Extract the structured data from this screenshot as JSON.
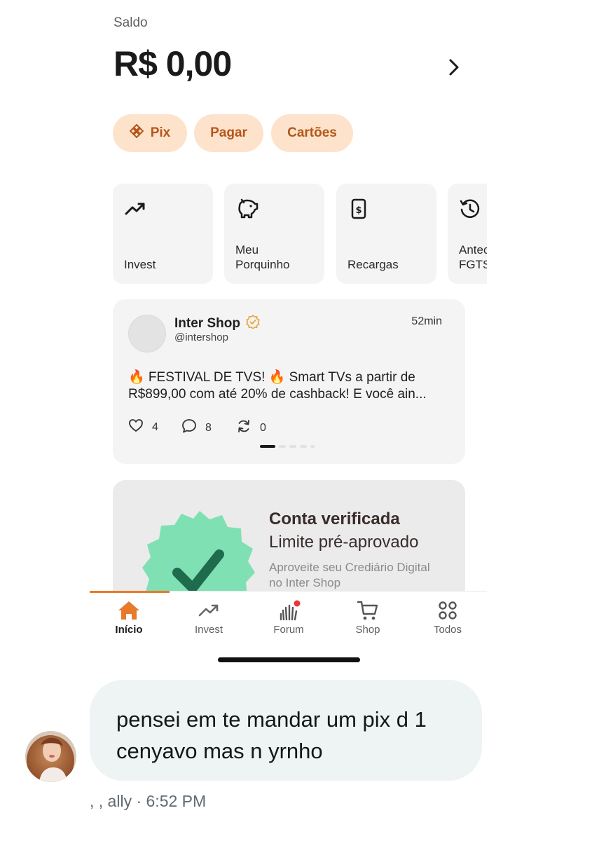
{
  "balance": {
    "label": "Saldo",
    "value": "R$ 0,00"
  },
  "chips": [
    {
      "label": "Pix",
      "icon": "pix-icon"
    },
    {
      "label": "Pagar"
    },
    {
      "label": "Cartões"
    }
  ],
  "shortcuts": [
    {
      "label": "Invest",
      "icon": "trending-up-icon"
    },
    {
      "label": "Meu\nPorquinho",
      "icon": "piggy-bank-icon"
    },
    {
      "label": "Recargas",
      "icon": "phone-recharge-icon"
    },
    {
      "label": "Antecipação\nFGTS",
      "icon": "history-clock-icon"
    }
  ],
  "post": {
    "author": "Inter Shop",
    "handle": "@intershop",
    "time": "52min",
    "text": "🔥 FESTIVAL DE TVS! 🔥 Smart TVs a partir de R$899,00 com até 20% de cashback! E você ain...",
    "likes": "4",
    "comments": "8",
    "reposts": "0",
    "page_count": 5,
    "current_page": 1
  },
  "promo": {
    "title": "Conta verificada",
    "subtitle": "Limite pré-aprovado",
    "description": "Aproveite seu Crediário Digital no Inter Shop",
    "seal_color": "#7fe0b4",
    "check_color": "#1f6b4e"
  },
  "nav": {
    "items": [
      {
        "label": "Início",
        "icon": "home-icon",
        "active": true
      },
      {
        "label": "Invest",
        "icon": "trending-up-icon"
      },
      {
        "label": "Forum",
        "icon": "forum-icon",
        "badge": true
      },
      {
        "label": "Shop",
        "icon": "cart-icon"
      },
      {
        "label": "Todos",
        "icon": "grid-icon"
      }
    ],
    "accent": "#e77a2b"
  },
  "chat": {
    "message": "pensei em te mandar um pix d 1 cenyavo mas n yrnho",
    "sender": ", , ally",
    "time": "6:52 PM",
    "meta": ", , ally · 6:52 PM"
  },
  "colors": {
    "chip_bg": "#fde3cb",
    "chip_text": "#b5561a",
    "card_bg": "#f4f4f4",
    "bubble_bg": "#eef3f4"
  }
}
